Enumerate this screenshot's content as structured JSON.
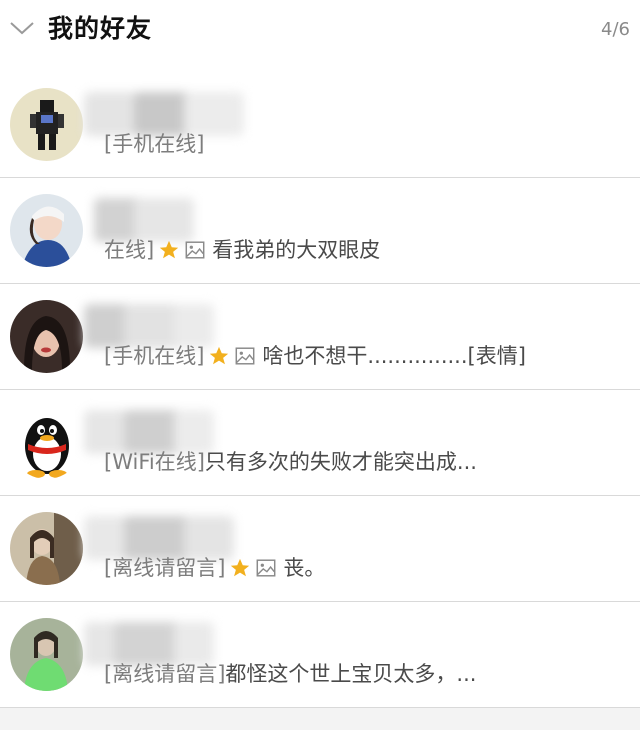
{
  "header": {
    "title": "我的好友",
    "count": "4/6",
    "chevron_icon": "chevron-down-icon"
  },
  "friends": [
    {
      "status": "[手机在线]",
      "star": false,
      "image": false,
      "message": ""
    },
    {
      "status": "在线]",
      "star": true,
      "image": true,
      "message": "看我弟的大双眼皮"
    },
    {
      "status": "[手机在线]",
      "star": true,
      "image": true,
      "message": "啥也不想干...............[表情]"
    },
    {
      "status": "[WiFi在线]",
      "star": false,
      "image": false,
      "message": "只有多次的失败才能突出成..."
    },
    {
      "status": "[离线请留言]",
      "star": true,
      "image": true,
      "message": "丧。"
    },
    {
      "status": "[离线请留言]",
      "star": false,
      "image": false,
      "message": "都怪这个世上宝贝太多，..."
    }
  ],
  "colors": {
    "star": "#f2b01e",
    "divider": "#d9d9d9",
    "muted": "#8a8a8a"
  }
}
